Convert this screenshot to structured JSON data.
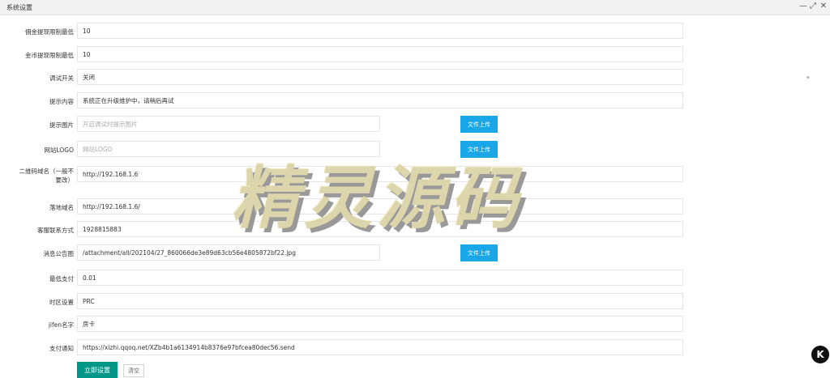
{
  "window": {
    "title": "系统设置",
    "minimize": "—",
    "maximize": "⤢",
    "close": "✕"
  },
  "form": {
    "commission_min": {
      "label": "佣金提现限制最低",
      "value": "10"
    },
    "coin_min": {
      "label": "金币提现限制最低",
      "value": "10"
    },
    "debug_switch": {
      "label": "调试开关",
      "value": "关闭",
      "arrow": "▾"
    },
    "notice_content": {
      "label": "提示内容",
      "value": "系统正在升级维护中，请稍后再试"
    },
    "notice_image": {
      "label": "提示图片",
      "placeholder": "开启调试时提示图片",
      "upload": "文件上传"
    },
    "site_logo": {
      "label": "网站LOGO",
      "placeholder": "网站LOGO",
      "upload": "文件上传"
    },
    "qr_domain": {
      "label": "二维码域名（一般不要改）",
      "value": "http://192.168.1.6"
    },
    "landing_domain": {
      "label": "落地域名",
      "value": "http://192.168.1.6/"
    },
    "service_contact": {
      "label": "客服联系方式",
      "value": "1928815883"
    },
    "notice_image2": {
      "label": "消息公告图",
      "value": "/attachment/all/202104/27_860066de3e89d63cb56e4805872bf22.jpg",
      "upload": "文件上传"
    },
    "min_pay": {
      "label": "最低支付",
      "value": "0.01"
    },
    "timezone": {
      "label": "时区设置",
      "value": "PRC"
    },
    "jifen_name": {
      "label": "jifen名字",
      "value": "房卡"
    },
    "pay_notify": {
      "label": "支付通知",
      "value": "https://xizhi.qqoq.net/XZb4b1a6134914b8376e97bfcea80dec56.send"
    }
  },
  "actions": {
    "submit": "立即设置",
    "reset": "清空"
  },
  "watermark": "精灵源码",
  "corner_logo": "K",
  "colors": {
    "accent": "#009688",
    "upload": "#1aa7e8"
  }
}
